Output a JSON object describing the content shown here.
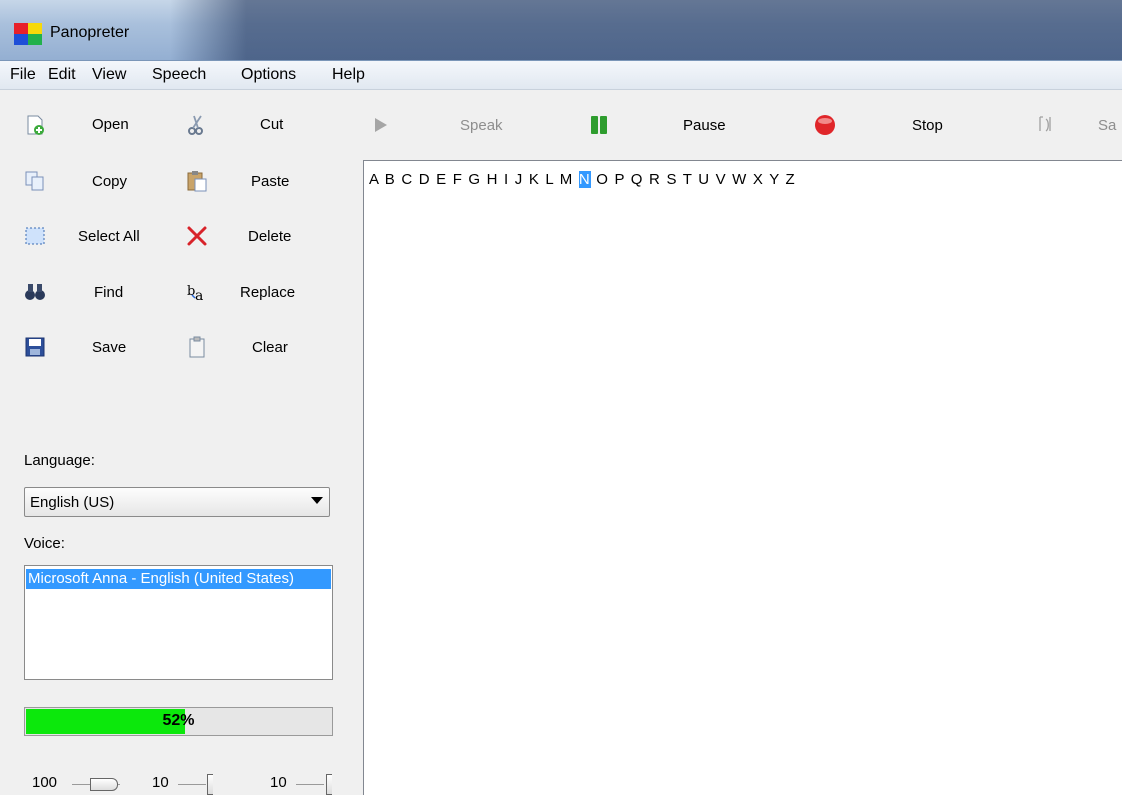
{
  "window": {
    "title": "Panopreter"
  },
  "menu": [
    "File",
    "Edit",
    "View",
    "Speech",
    "Options",
    "Help"
  ],
  "left_toolbar": {
    "open": "Open",
    "cut": "Cut",
    "copy": "Copy",
    "paste": "Paste",
    "select_all": "Select All",
    "delete": "Delete",
    "find": "Find",
    "replace": "Replace",
    "save": "Save",
    "clear": "Clear"
  },
  "speech_toolbar": {
    "speak": "Speak",
    "pause": "Pause",
    "stop": "Stop",
    "save_partial": "Sa"
  },
  "language": {
    "label": "Language:",
    "value": "English (US)"
  },
  "voice": {
    "label": "Voice:",
    "selected": "Microsoft Anna - English (United States)"
  },
  "progress": {
    "value": 0.52,
    "text": "52%"
  },
  "sliders": {
    "volume": "100",
    "rate": "10",
    "pitch": "10"
  },
  "editor": {
    "text_before": "A B C D E F G H I J K L M ",
    "highlighted": "N",
    "text_after": " O P Q R S T U V W X Y Z"
  },
  "colors": {
    "selection": "#3399ff",
    "progress": "#0ce80c",
    "stop": "#e0262a",
    "pause": "#2e9d2e"
  }
}
